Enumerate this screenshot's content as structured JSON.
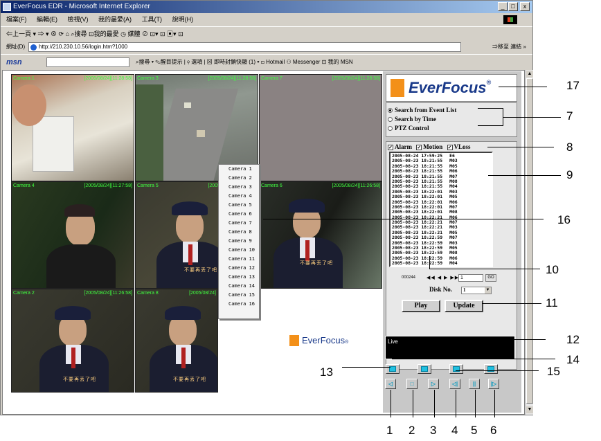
{
  "window": {
    "title": "EverFocus EDR - Microsoft Internet Explorer",
    "minimize": "_",
    "maximize": "□",
    "close": "x"
  },
  "menu": [
    "檔案(F)",
    "編輯(E)",
    "檢視(V)",
    "我的最愛(A)",
    "工具(T)",
    "說明(H)"
  ],
  "toolbar_text": "⇐上一頁 ▾ ⇒ ▾  ⊗  ⟳  ⌂   ⌕搜尋  ⊡我的最愛  ◷ 媒體  ⊘  ⊡▾  ⊡  ▣▾  ⊡",
  "address": {
    "label": "網址(D)",
    "value": "http://210.230.10.56/login.htm?1000",
    "go": "⇒移至  連結 »"
  },
  "links": {
    "logo": "msn",
    "text": "⌕搜尋 ▾  ✎醒目提示  |  ⚲ 選項  |  ⊠ 即時封鎖快顯 (1) ▾  ⊡ Hotmail  ⚇ Messenger  ⊡ 我的 MSN"
  },
  "cameras": [
    {
      "label": "Camera 1",
      "time": "[2005/08/24][11:28:58]"
    },
    {
      "label": "Camera 3",
      "time": "[2005/08/24][11:28:58]"
    },
    {
      "label": "Camera 7",
      "time": "[2005/08/24][11:28:58]"
    },
    {
      "label": "Camera 4",
      "time": "[2005/08/24][11:27:58]"
    },
    {
      "label": "Camera 5",
      "time": "[2005/08/24][11:26:58]"
    },
    {
      "label": "Camera 6",
      "time": "[2005/08/24][11:26:58]"
    },
    {
      "label": "Camera 2",
      "time": "[2005/08/24][11:26:58]"
    },
    {
      "label": "Camera 8",
      "time": "[2005/08/24]"
    }
  ],
  "subtitle_text": "不要再丢了吧",
  "camera_menu": [
    "Camera 1",
    "Camera 2",
    "Camera 3",
    "Camera 4",
    "Camera 5",
    "Camera 6",
    "Camera 7",
    "Camera 8",
    "Camera 9",
    "Camera 10",
    "Camera 11",
    "Camera 12",
    "Camera 13",
    "Camera 14",
    "Camera 15",
    "Camera 16"
  ],
  "logo": {
    "brand": "EverFocus",
    "reg": "®"
  },
  "search_options": [
    {
      "label": "Search from Event List",
      "selected": true
    },
    {
      "label": "Search by Time",
      "selected": false
    },
    {
      "label": "PTZ Control",
      "selected": false
    }
  ],
  "filters": [
    {
      "label": "Alarm",
      "checked": true
    },
    {
      "label": "Motion",
      "checked": true
    },
    {
      "label": "VLoss",
      "checked": true
    }
  ],
  "events": [
    {
      "time": "2005-08-24 17:59:25",
      "code": "E6"
    },
    {
      "time": "2005-08-23 18:21:55",
      "code": "M03"
    },
    {
      "time": "2005-08-23 18:21:55",
      "code": "M05"
    },
    {
      "time": "2005-08-23 18:21:55",
      "code": "M06"
    },
    {
      "time": "2005-08-23 18:21:55",
      "code": "M07"
    },
    {
      "time": "2005-08-23 18:21:55",
      "code": "M08"
    },
    {
      "time": "2005-08-23 18:21:55",
      "code": "M04"
    },
    {
      "time": "2005-08-23 18:22:01",
      "code": "M03"
    },
    {
      "time": "2005-08-23 18:22:01",
      "code": "M05"
    },
    {
      "time": "2005-08-23 18:22:01",
      "code": "M06"
    },
    {
      "time": "2005-08-23 18:22:01",
      "code": "M07"
    },
    {
      "time": "2005-08-23 18:22:01",
      "code": "M08"
    },
    {
      "time": "2005-08-23 18:22:21",
      "code": "M06"
    },
    {
      "time": "2005-08-23 18:22:21",
      "code": "M07"
    },
    {
      "time": "2005-08-23 18:22:21",
      "code": "M03"
    },
    {
      "time": "2005-08-23 18:22:21",
      "code": "M05"
    },
    {
      "time": "2005-08-23 18:22:59",
      "code": "M07"
    },
    {
      "time": "2005-08-23 18:22:59",
      "code": "M03"
    },
    {
      "time": "2005-08-23 18:22:59",
      "code": "M05"
    },
    {
      "time": "2005-08-23 18:22:59",
      "code": "M08"
    },
    {
      "time": "2005-08-23 18:22:59",
      "code": "M06"
    },
    {
      "time": "2005-08-23 18:22:59",
      "code": "M04"
    }
  ],
  "event_nav": {
    "total": "000244",
    "buttons": "◀◀ ◀ ▶ ▶▶",
    "page": "1",
    "go": "GO"
  },
  "disk": {
    "label": "Disk No.",
    "value": "1"
  },
  "buttons": {
    "play": "Play",
    "update": "Update"
  },
  "status": "Live",
  "playback": [
    "◁",
    "□",
    "▷",
    "◁|",
    "||",
    "|▷"
  ],
  "callouts": [
    "1",
    "2",
    "3",
    "4",
    "5",
    "6",
    "7",
    "8",
    "9",
    "10",
    "11",
    "12",
    "13",
    "14",
    "15",
    "16",
    "17"
  ]
}
